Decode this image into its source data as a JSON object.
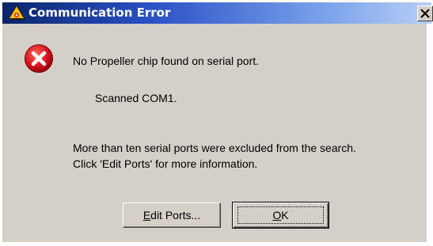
{
  "dialog": {
    "title": "Communication Error",
    "close_glyph": "×",
    "icon": "error-icon",
    "messages": {
      "main": "No Propeller chip found on serial port.",
      "scanned": "Scanned COM1.",
      "excluded_line1": "More than ten serial ports were excluded from the search.",
      "excluded_line2": "Click 'Edit Ports' for more information."
    },
    "buttons": {
      "edit_ports": {
        "mnemonic": "E",
        "rest": "dit Ports..."
      },
      "ok": {
        "mnemonic": "O",
        "rest": "K"
      }
    }
  },
  "colors": {
    "titlebar_start": "#0a246a",
    "titlebar_end": "#b8cff7",
    "panel": "#d4d0c8",
    "error_red": "#d8121c"
  }
}
